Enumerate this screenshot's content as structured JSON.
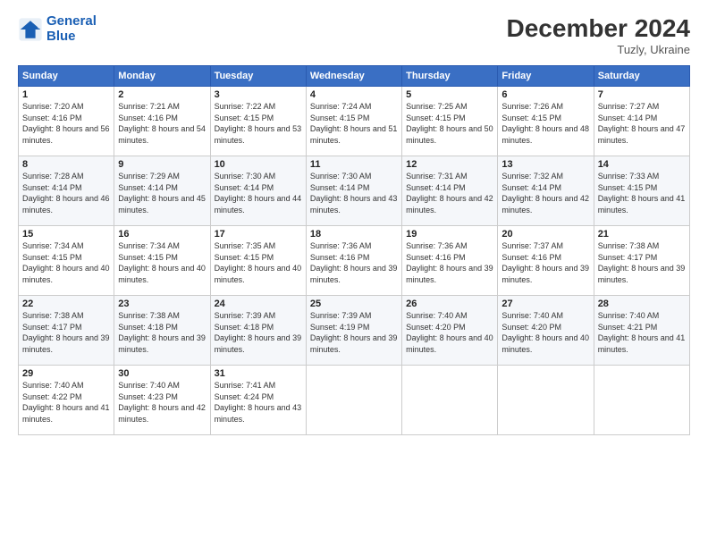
{
  "logo": {
    "line1": "General",
    "line2": "Blue"
  },
  "title": "December 2024",
  "location": "Tuzly, Ukraine",
  "days_of_week": [
    "Sunday",
    "Monday",
    "Tuesday",
    "Wednesday",
    "Thursday",
    "Friday",
    "Saturday"
  ],
  "weeks": [
    [
      {
        "day": "1",
        "sunrise": "7:20 AM",
        "sunset": "4:16 PM",
        "daylight": "8 hours and 56 minutes."
      },
      {
        "day": "2",
        "sunrise": "7:21 AM",
        "sunset": "4:16 PM",
        "daylight": "8 hours and 54 minutes."
      },
      {
        "day": "3",
        "sunrise": "7:22 AM",
        "sunset": "4:15 PM",
        "daylight": "8 hours and 53 minutes."
      },
      {
        "day": "4",
        "sunrise": "7:24 AM",
        "sunset": "4:15 PM",
        "daylight": "8 hours and 51 minutes."
      },
      {
        "day": "5",
        "sunrise": "7:25 AM",
        "sunset": "4:15 PM",
        "daylight": "8 hours and 50 minutes."
      },
      {
        "day": "6",
        "sunrise": "7:26 AM",
        "sunset": "4:15 PM",
        "daylight": "8 hours and 48 minutes."
      },
      {
        "day": "7",
        "sunrise": "7:27 AM",
        "sunset": "4:14 PM",
        "daylight": "8 hours and 47 minutes."
      }
    ],
    [
      {
        "day": "8",
        "sunrise": "7:28 AM",
        "sunset": "4:14 PM",
        "daylight": "8 hours and 46 minutes."
      },
      {
        "day": "9",
        "sunrise": "7:29 AM",
        "sunset": "4:14 PM",
        "daylight": "8 hours and 45 minutes."
      },
      {
        "day": "10",
        "sunrise": "7:30 AM",
        "sunset": "4:14 PM",
        "daylight": "8 hours and 44 minutes."
      },
      {
        "day": "11",
        "sunrise": "7:30 AM",
        "sunset": "4:14 PM",
        "daylight": "8 hours and 43 minutes."
      },
      {
        "day": "12",
        "sunrise": "7:31 AM",
        "sunset": "4:14 PM",
        "daylight": "8 hours and 42 minutes."
      },
      {
        "day": "13",
        "sunrise": "7:32 AM",
        "sunset": "4:14 PM",
        "daylight": "8 hours and 42 minutes."
      },
      {
        "day": "14",
        "sunrise": "7:33 AM",
        "sunset": "4:15 PM",
        "daylight": "8 hours and 41 minutes."
      }
    ],
    [
      {
        "day": "15",
        "sunrise": "7:34 AM",
        "sunset": "4:15 PM",
        "daylight": "8 hours and 40 minutes."
      },
      {
        "day": "16",
        "sunrise": "7:34 AM",
        "sunset": "4:15 PM",
        "daylight": "8 hours and 40 minutes."
      },
      {
        "day": "17",
        "sunrise": "7:35 AM",
        "sunset": "4:15 PM",
        "daylight": "8 hours and 40 minutes."
      },
      {
        "day": "18",
        "sunrise": "7:36 AM",
        "sunset": "4:16 PM",
        "daylight": "8 hours and 39 minutes."
      },
      {
        "day": "19",
        "sunrise": "7:36 AM",
        "sunset": "4:16 PM",
        "daylight": "8 hours and 39 minutes."
      },
      {
        "day": "20",
        "sunrise": "7:37 AM",
        "sunset": "4:16 PM",
        "daylight": "8 hours and 39 minutes."
      },
      {
        "day": "21",
        "sunrise": "7:38 AM",
        "sunset": "4:17 PM",
        "daylight": "8 hours and 39 minutes."
      }
    ],
    [
      {
        "day": "22",
        "sunrise": "7:38 AM",
        "sunset": "4:17 PM",
        "daylight": "8 hours and 39 minutes."
      },
      {
        "day": "23",
        "sunrise": "7:38 AM",
        "sunset": "4:18 PM",
        "daylight": "8 hours and 39 minutes."
      },
      {
        "day": "24",
        "sunrise": "7:39 AM",
        "sunset": "4:18 PM",
        "daylight": "8 hours and 39 minutes."
      },
      {
        "day": "25",
        "sunrise": "7:39 AM",
        "sunset": "4:19 PM",
        "daylight": "8 hours and 39 minutes."
      },
      {
        "day": "26",
        "sunrise": "7:40 AM",
        "sunset": "4:20 PM",
        "daylight": "8 hours and 40 minutes."
      },
      {
        "day": "27",
        "sunrise": "7:40 AM",
        "sunset": "4:20 PM",
        "daylight": "8 hours and 40 minutes."
      },
      {
        "day": "28",
        "sunrise": "7:40 AM",
        "sunset": "4:21 PM",
        "daylight": "8 hours and 41 minutes."
      }
    ],
    [
      {
        "day": "29",
        "sunrise": "7:40 AM",
        "sunset": "4:22 PM",
        "daylight": "8 hours and 41 minutes."
      },
      {
        "day": "30",
        "sunrise": "7:40 AM",
        "sunset": "4:23 PM",
        "daylight": "8 hours and 42 minutes."
      },
      {
        "day": "31",
        "sunrise": "7:41 AM",
        "sunset": "4:24 PM",
        "daylight": "8 hours and 43 minutes."
      },
      {
        "day": "",
        "sunrise": "",
        "sunset": "",
        "daylight": ""
      },
      {
        "day": "",
        "sunrise": "",
        "sunset": "",
        "daylight": ""
      },
      {
        "day": "",
        "sunrise": "",
        "sunset": "",
        "daylight": ""
      },
      {
        "day": "",
        "sunrise": "",
        "sunset": "",
        "daylight": ""
      }
    ]
  ],
  "labels": {
    "sunrise": "Sunrise:",
    "sunset": "Sunset:",
    "daylight": "Daylight:"
  }
}
